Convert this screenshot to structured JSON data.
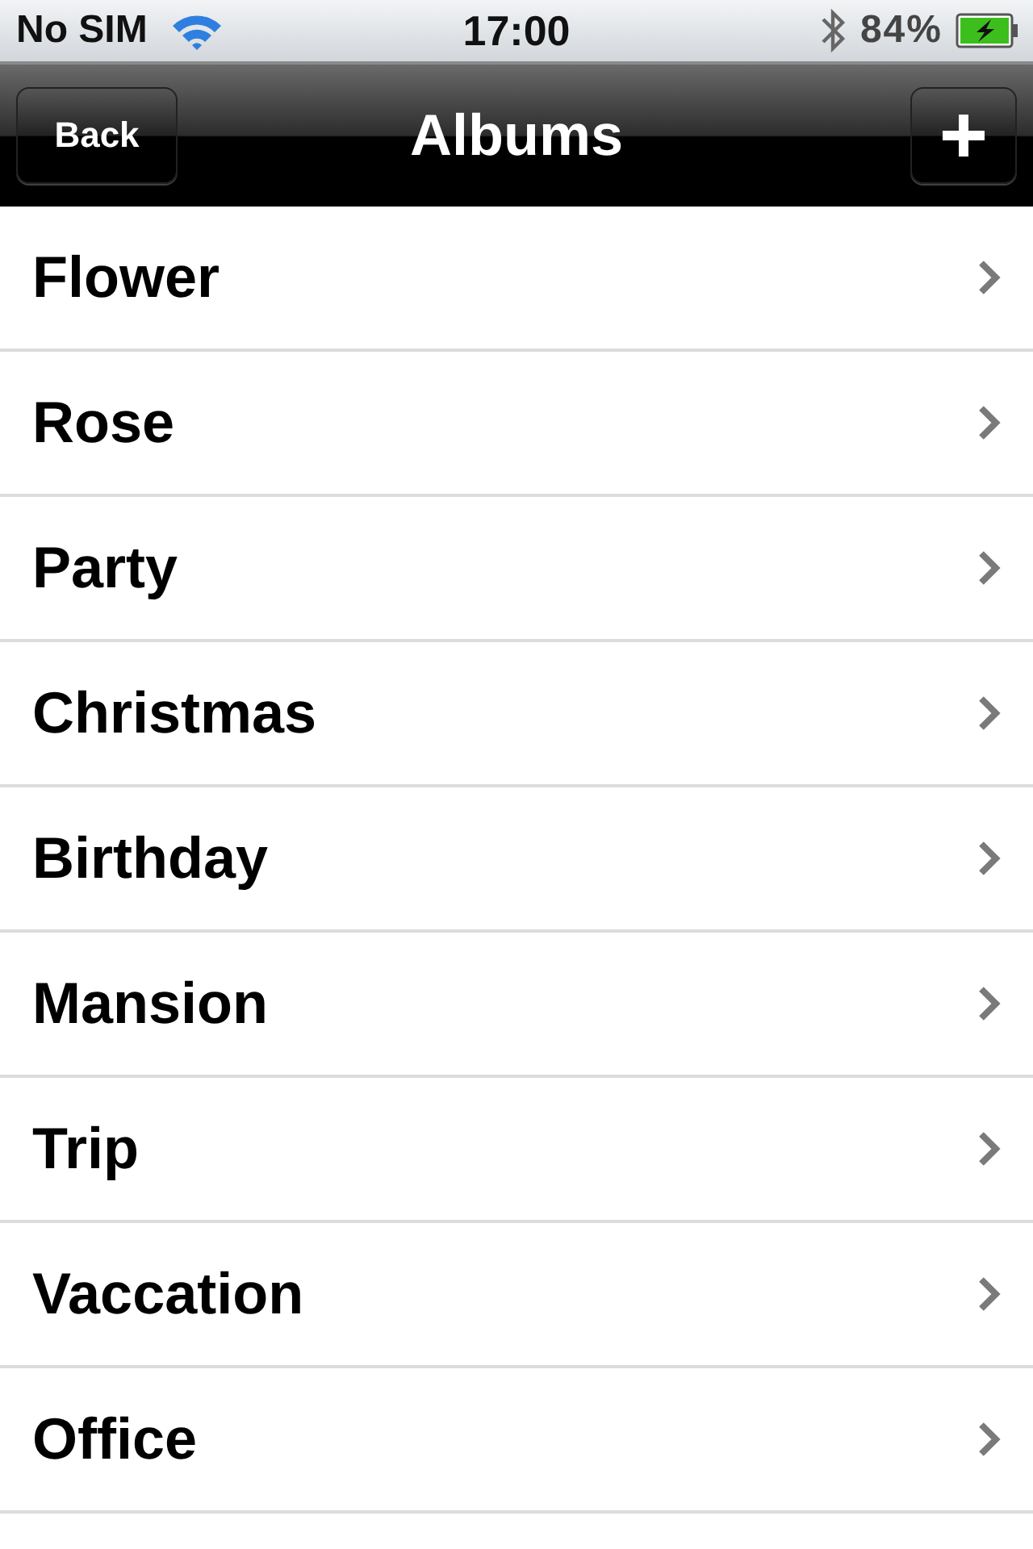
{
  "status_bar": {
    "carrier": "No SIM",
    "time": "17:00",
    "battery": "84%"
  },
  "nav_bar": {
    "title": "Albums",
    "back_button": "Back"
  },
  "albums": [
    {
      "name": "Flower"
    },
    {
      "name": "Rose"
    },
    {
      "name": "Party"
    },
    {
      "name": "Christmas"
    },
    {
      "name": "Birthday"
    },
    {
      "name": "Mansion"
    },
    {
      "name": "Trip"
    },
    {
      "name": "Vaccation"
    },
    {
      "name": "Office"
    }
  ]
}
